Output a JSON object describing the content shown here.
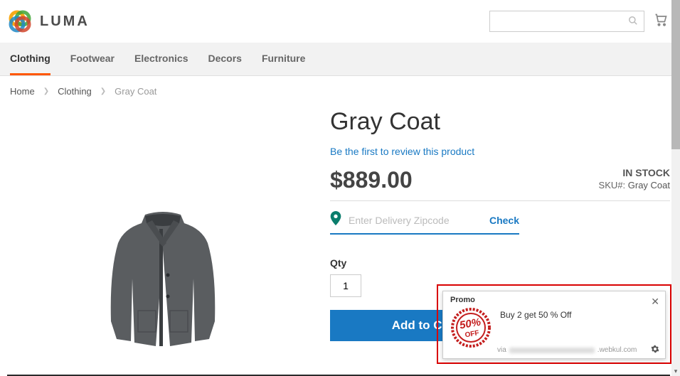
{
  "brand": "LUMA",
  "nav": [
    {
      "label": "Clothing",
      "active": true
    },
    {
      "label": "Footwear",
      "active": false
    },
    {
      "label": "Electronics",
      "active": false
    },
    {
      "label": "Decors",
      "active": false
    },
    {
      "label": "Furniture",
      "active": false
    }
  ],
  "search": {
    "placeholder": ""
  },
  "breadcrumb": {
    "home": "Home",
    "category": "Clothing",
    "current": "Gray Coat"
  },
  "product": {
    "title": "Gray Coat",
    "review_link": "Be the first to review this product",
    "price": "$889.00",
    "stock_status": "IN STOCK",
    "sku_label": "SKU#:",
    "sku_value": "Gray Coat",
    "zipcode_placeholder": "Enter Delivery Zipcode",
    "check_label": "Check",
    "qty_label": "Qty",
    "qty_value": "1",
    "add_to_cart": "Add to Cart"
  },
  "promo": {
    "header": "Promo",
    "badge_top": "50%",
    "badge_bottom": "OFF",
    "text": "Buy 2 get 50 % Off",
    "via": "via",
    "domain": ".webkul.com"
  }
}
